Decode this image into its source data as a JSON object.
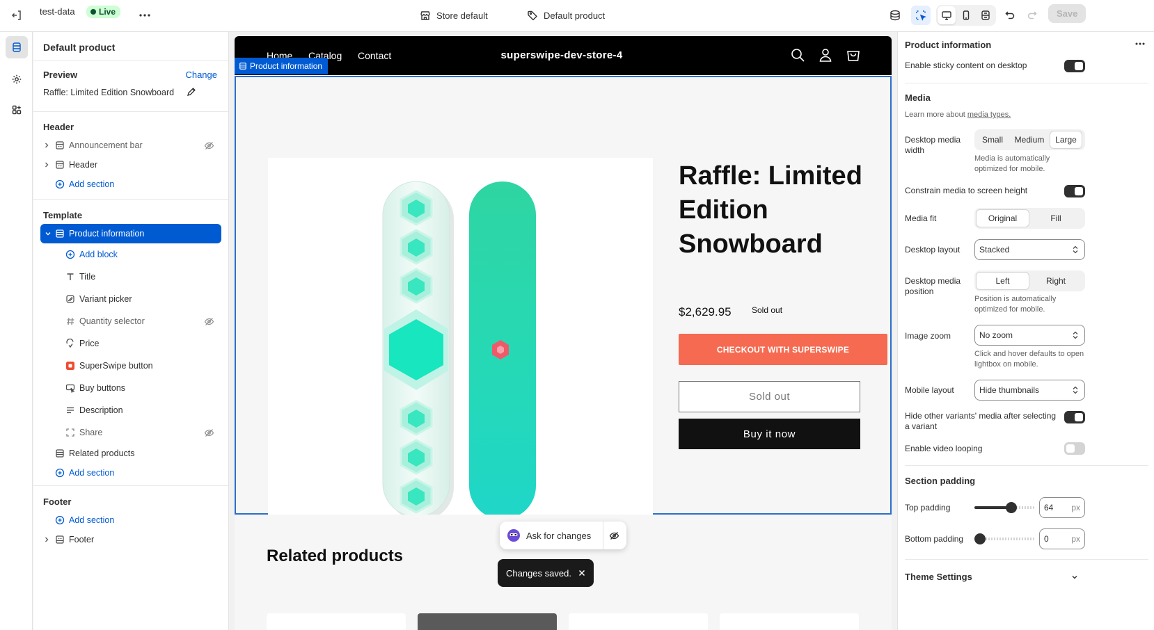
{
  "topbar": {
    "store_handle": "test-data",
    "status": "Live",
    "template_scope": "Store default",
    "template_name": "Default product",
    "save_label": "Save"
  },
  "sidebar": {
    "title": "Default product",
    "preview_label": "Preview",
    "change_label": "Change",
    "preview_product": "Raffle: Limited Edition Snowboard",
    "header_group": {
      "title": "Header",
      "items": [
        {
          "label": "Announcement bar",
          "hidden": true
        },
        {
          "label": "Header",
          "hidden": false
        }
      ],
      "add_label": "Add section"
    },
    "template_group": {
      "title": "Template",
      "selected_section": "Product information",
      "add_block_label": "Add block",
      "blocks": [
        {
          "label": "Title",
          "icon": "text-icon",
          "hidden": false
        },
        {
          "label": "Variant picker",
          "icon": "variant-icon",
          "hidden": false
        },
        {
          "label": "Quantity selector",
          "icon": "hash-icon",
          "hidden": true
        },
        {
          "label": "Price",
          "icon": "price-icon",
          "hidden": false
        },
        {
          "label": "SuperSwipe button",
          "icon": "app-block-icon",
          "hidden": false
        },
        {
          "label": "Buy buttons",
          "icon": "buy-icon",
          "hidden": false
        },
        {
          "label": "Description",
          "icon": "text-lines-icon",
          "hidden": false
        },
        {
          "label": "Share",
          "icon": "share-icon",
          "hidden": true
        }
      ],
      "extra_section": "Related products",
      "add_label": "Add section"
    },
    "footer_group": {
      "title": "Footer",
      "add_label": "Add section",
      "items": [
        {
          "label": "Footer"
        }
      ]
    }
  },
  "canvas": {
    "nav": [
      "Home",
      "Catalog",
      "Contact"
    ],
    "store_name": "superswipe-dev-store-4",
    "section_tag": "Product information",
    "product_title": "Raffle: Limited Edition Snowboard",
    "price": "$2,629.95",
    "badge": "Sold out",
    "checkout_label": "CHECKOUT WITH SUPERSWIPE",
    "soldout_button": "Sold out",
    "buy_now": "Buy it now",
    "related_title": "Related products",
    "ask_label": "Ask for changes",
    "toast": "Changes saved."
  },
  "panel": {
    "title": "Product information",
    "sticky_label": "Enable sticky content on desktop",
    "sticky_on": true,
    "media_head": "Media",
    "media_help_prefix": "Learn more about ",
    "media_help_link": "media types.",
    "desktop_media_width": {
      "label": "Desktop media width",
      "options": [
        "Small",
        "Medium",
        "Large"
      ],
      "selected": "Large",
      "help": "Media is automatically optimized for mobile."
    },
    "constrain_label": "Constrain media to screen height",
    "constrain_on": true,
    "media_fit": {
      "label": "Media fit",
      "options": [
        "Original",
        "Fill"
      ],
      "selected": "Original"
    },
    "desktop_layout": {
      "label": "Desktop layout",
      "value": "Stacked"
    },
    "desktop_media_position": {
      "label": "Desktop media position",
      "options": [
        "Left",
        "Right"
      ],
      "selected": "Left",
      "help": "Position is automatically optimized for mobile."
    },
    "image_zoom": {
      "label": "Image zoom",
      "value": "No zoom",
      "help": "Click and hover defaults to open lightbox on mobile."
    },
    "mobile_layout": {
      "label": "Mobile layout",
      "value": "Hide thumbnails"
    },
    "hide_variants_label": "Hide other variants' media after selecting a variant",
    "hide_variants_on": true,
    "video_loop_label": "Enable video looping",
    "video_loop_on": false,
    "padding_head": "Section padding",
    "top_padding": {
      "label": "Top padding",
      "value": "64",
      "unit": "px",
      "fraction": 0.64
    },
    "bottom_padding": {
      "label": "Bottom padding",
      "value": "0",
      "unit": "px",
      "fraction": 0.0
    },
    "theme_settings": "Theme Settings"
  },
  "colors": {
    "accent": "#005bd3",
    "checkout": "#f56a50",
    "live_badge_bg": "#cdfed4"
  }
}
